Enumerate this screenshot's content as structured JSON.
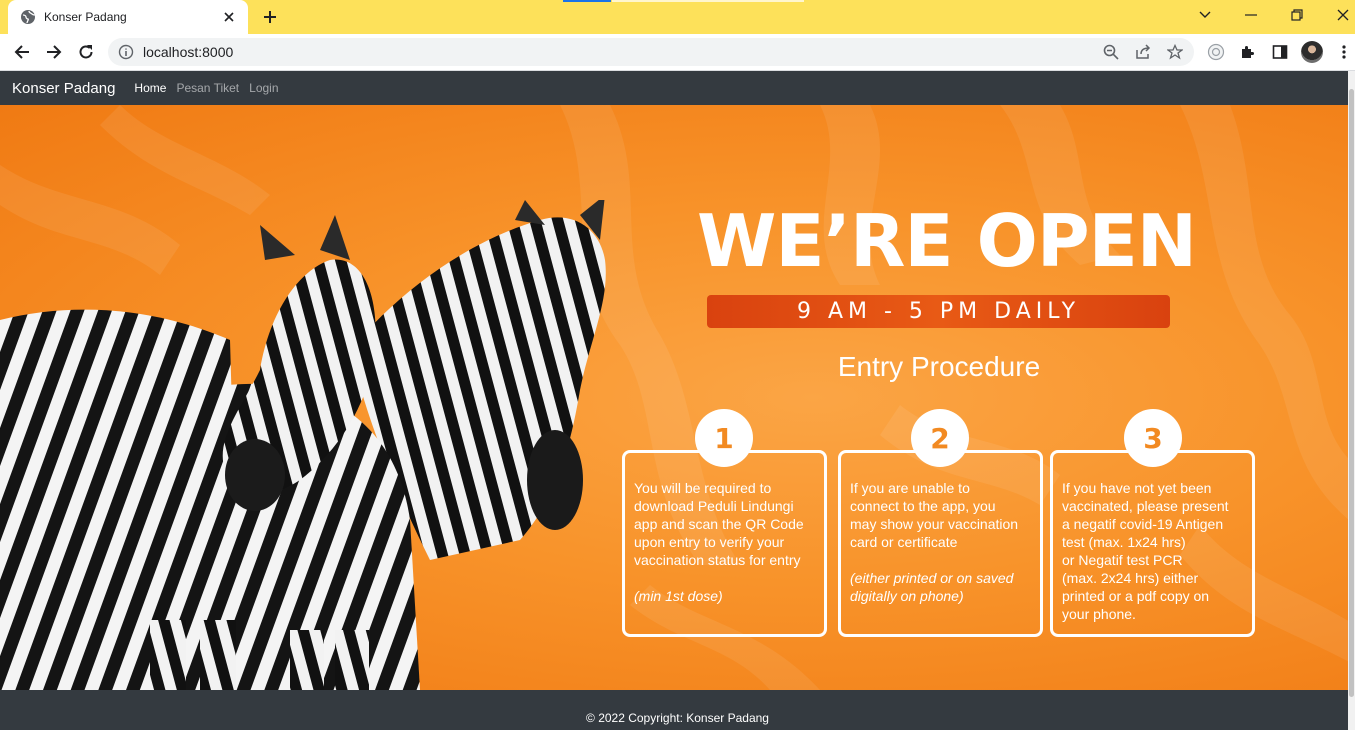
{
  "browser": {
    "tab_title": "Konser Padang",
    "url": "localhost:8000",
    "accent": "#fde15a"
  },
  "navbar": {
    "brand": "Konser Padang",
    "links": [
      {
        "label": "Home",
        "active": true
      },
      {
        "label": "Pesan Tiket",
        "active": false
      },
      {
        "label": "Login",
        "active": false
      }
    ]
  },
  "hero": {
    "headline": "WE’RE OPEN",
    "hours": "9 AM - 5 PM DAILY",
    "procedure_title": "Entry Procedure",
    "colors": {
      "orange": "#f8932a",
      "banner": "#e04c10"
    },
    "steps": [
      {
        "number": "1",
        "text": "You will be required to\ndownload Peduli Lindungi\napp and scan the QR Code\nupon entry to verify your\nvaccination status for entry",
        "note": "(min 1st dose)"
      },
      {
        "number": "2",
        "text": "If you are unable to\nconnect to the app, you\nmay show your vaccination\ncard or certificate",
        "note": "(either printed or on saved\ndigitally on phone)"
      },
      {
        "number": "3",
        "text": "If you have not yet been\nvaccinated, please present\na negatif covid-19 Antigen\ntest (max. 1x24 hrs)\nor Negatif test PCR\n(max. 2x24 hrs) either\nprinted or a pdf copy on\nyour phone.",
        "note": ""
      }
    ]
  },
  "footer": {
    "copyright": "© 2022 Copyright: Konser Padang"
  }
}
